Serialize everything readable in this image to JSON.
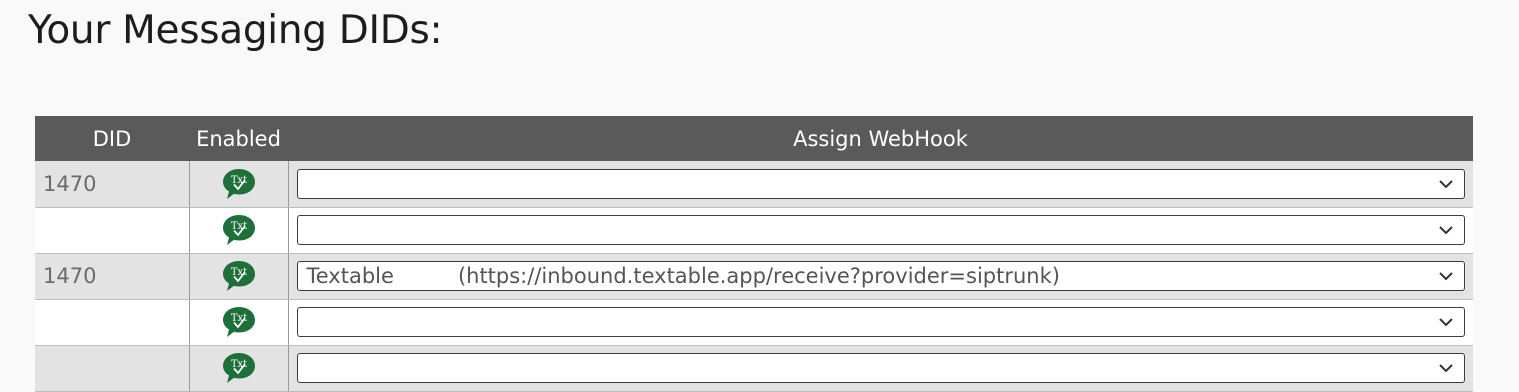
{
  "page": {
    "title": "Your Messaging DIDs:"
  },
  "table": {
    "headers": {
      "did": "DID",
      "enabled": "Enabled",
      "webhook": "Assign WebHook"
    },
    "rows": [
      {
        "did": "1470",
        "enabled_icon": "txt-check-badge-icon",
        "webhook_name": "",
        "webhook_url": ""
      },
      {
        "did": "",
        "enabled_icon": "txt-check-badge-icon",
        "webhook_name": "",
        "webhook_url": ""
      },
      {
        "did": "1470",
        "enabled_icon": "txt-check-badge-icon",
        "webhook_name": "Textable",
        "webhook_url": "(https://inbound.textable.app/receive?provider=siptrunk)"
      },
      {
        "did": "",
        "enabled_icon": "txt-check-badge-icon",
        "webhook_name": "",
        "webhook_url": ""
      },
      {
        "did": "",
        "enabled_icon": "txt-check-badge-icon",
        "webhook_name": "",
        "webhook_url": ""
      }
    ]
  },
  "colors": {
    "header_bg": "#5a5a5a",
    "badge_green": "#1f6f3a",
    "row_alt": "#e3e3e3"
  }
}
